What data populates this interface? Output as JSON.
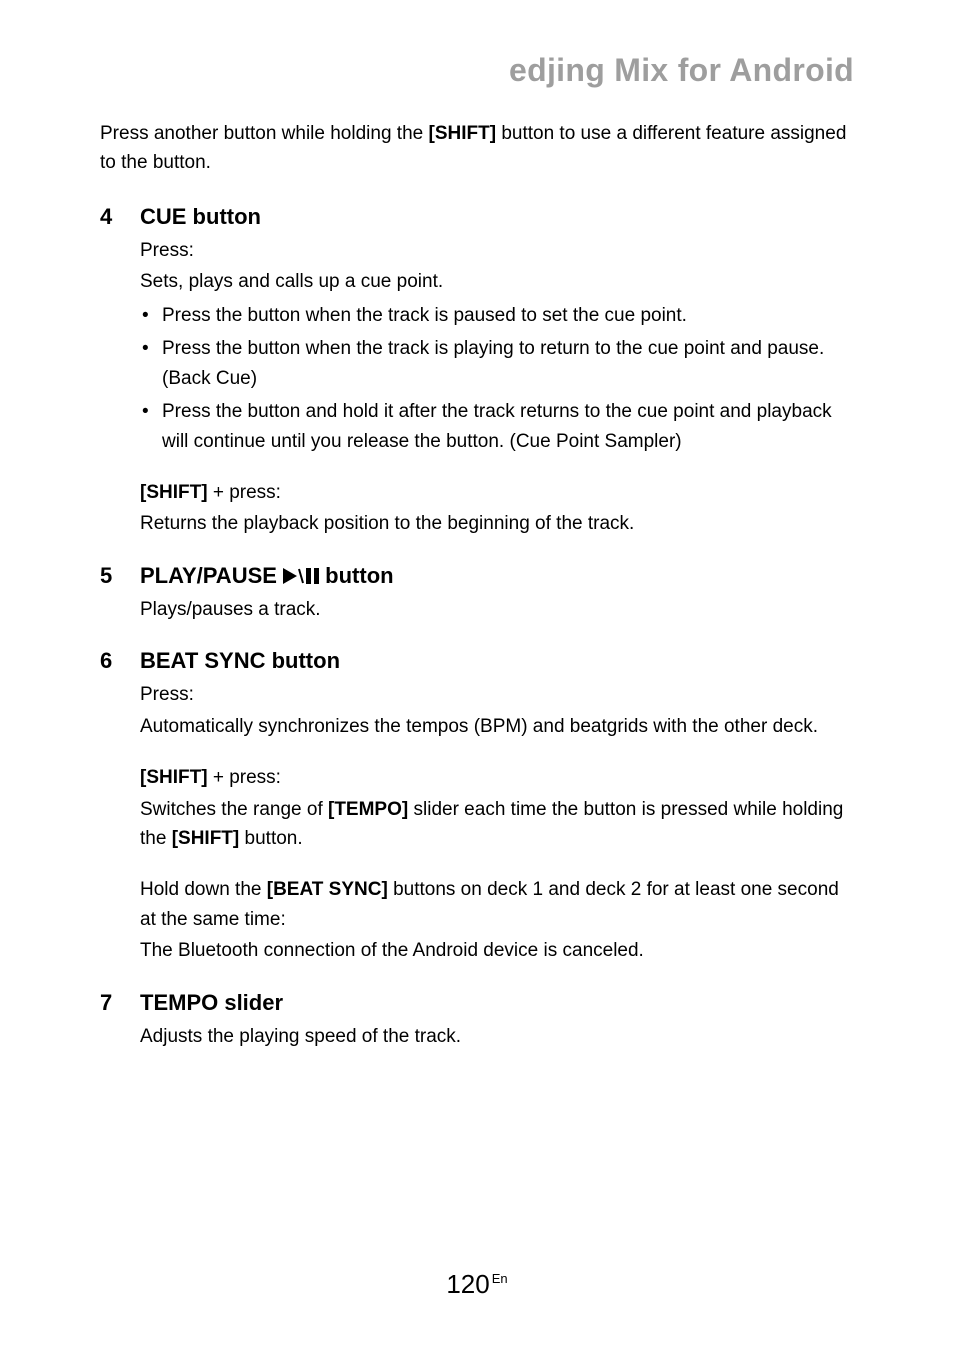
{
  "page_title": "edjing Mix for Android",
  "intro_pre": "Press another button while holding the ",
  "intro_bold": "[SHIFT]",
  "intro_post": " button to use a different feature assigned to the button.",
  "sections": {
    "s4": {
      "num": "4",
      "title": "CUE button",
      "press_label": "Press:",
      "press_desc": "Sets, plays and calls up a cue point.",
      "bul1": "Press the button when the track is paused to set the cue point.",
      "bul2": "Press the button when the track is playing to return to the cue point and pause. (Back Cue)",
      "bul3": "Press the button and hold it after the track returns to the cue point and playback will continue until you release the button. (Cue Point Sampler)",
      "shift_label_bold": "[SHIFT]",
      "shift_label_rest": " + press:",
      "shift_desc": "Returns the playback position to the beginning of the track."
    },
    "s5": {
      "num": "5",
      "title_pre": "PLAY/PAUSE ",
      "title_post": " button",
      "desc": "Plays/pauses a track."
    },
    "s6": {
      "num": "6",
      "title": "BEAT SYNC button",
      "press_label": "Press:",
      "press_desc": "Automatically synchronizes the tempos (BPM) and beatgrids with the other deck.",
      "shift_label_bold": "[SHIFT]",
      "shift_label_rest": " + press:",
      "shift_p1_pre": "Switches the range of ",
      "shift_p1_b1": "[TEMPO]",
      "shift_p1_mid": " slider each time the button is pressed while holding the ",
      "shift_p1_b2": "[SHIFT]",
      "shift_p1_post": " button.",
      "hold_pre": "Hold down the ",
      "hold_bold": "[BEAT SYNC]",
      "hold_post": " buttons on deck 1 and deck 2 for at least one second at the same time:",
      "hold_desc": "The Bluetooth connection of the Android device is canceled."
    },
    "s7": {
      "num": "7",
      "title": "TEMPO slider",
      "desc": "Adjusts the playing speed of the track."
    }
  },
  "footer_page": "120",
  "footer_lang": "En"
}
